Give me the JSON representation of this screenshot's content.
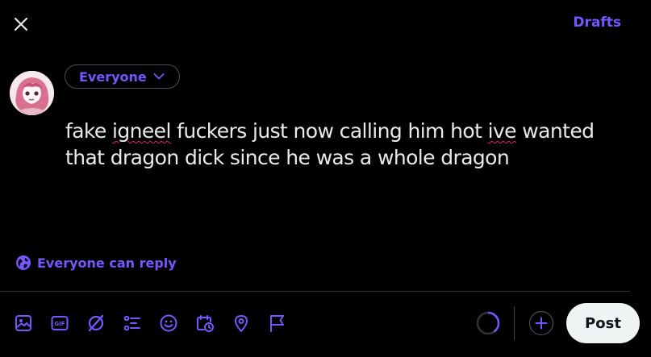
{
  "header": {
    "close_icon": "close-icon",
    "drafts_label": "Drafts"
  },
  "composer": {
    "audience_label": "Everyone",
    "text_parts": [
      "fake ",
      "igneel",
      " fuckers just now calling him hot ",
      "ive",
      " wanted that dragon dick since he was a whole dragon"
    ],
    "misspelled_parts": [
      "igneel",
      "ive"
    ]
  },
  "reply_setting": {
    "label": "Everyone can reply",
    "icon": "globe-icon"
  },
  "toolbar": {
    "icons": [
      "image-icon",
      "gif-icon",
      "grok-icon",
      "poll-icon",
      "emoji-icon",
      "schedule-icon",
      "location-icon",
      "flag-icon"
    ],
    "gif_label": "GIF"
  },
  "actions": {
    "add_icon": "plus-icon",
    "post_label": "Post",
    "char_progress_fraction": 0.4
  },
  "colors": {
    "accent": "#7856ff",
    "background": "#000000",
    "text": "#e7e9ea",
    "post_button_bg": "#eff3f4",
    "spellcheck": "#e0245e"
  }
}
